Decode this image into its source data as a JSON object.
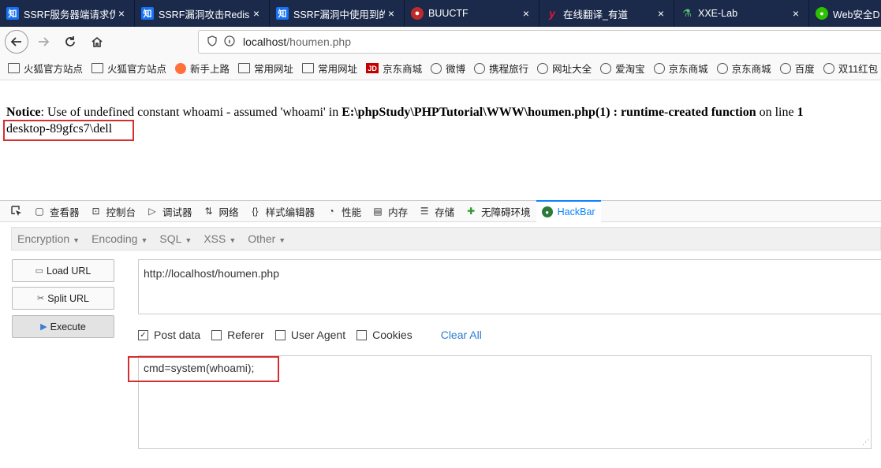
{
  "tabs": [
    {
      "icon": "知",
      "title": "SSRF服务器端请求伪"
    },
    {
      "icon": "知",
      "title": "SSRF漏洞攻击Redis"
    },
    {
      "icon": "知",
      "title": "SSRF漏洞中使用到的"
    },
    {
      "icon": "",
      "title": "BUUCTF"
    },
    {
      "icon": "y",
      "title": "在线翻译_有道"
    },
    {
      "icon": "",
      "title": "XXE-Lab"
    },
    {
      "icon": "",
      "title": "Web安全D"
    }
  ],
  "tab_close": "×",
  "nav": {
    "url_host": "localhost",
    "url_path": "/houmen.php"
  },
  "bookmarks": [
    {
      "type": "folder",
      "label": "火狐官方站点"
    },
    {
      "type": "folder",
      "label": "火狐官方站点"
    },
    {
      "type": "firefox",
      "label": "新手上路"
    },
    {
      "type": "folder",
      "label": "常用网址"
    },
    {
      "type": "folder",
      "label": "常用网址"
    },
    {
      "type": "jd",
      "icon_text": "JD",
      "label": "京东商城"
    },
    {
      "type": "globe",
      "label": "微博"
    },
    {
      "type": "globe",
      "label": "携程旅行"
    },
    {
      "type": "globe",
      "label": "网址大全"
    },
    {
      "type": "globe",
      "label": "爱淘宝"
    },
    {
      "type": "globe",
      "label": "京东商城"
    },
    {
      "type": "globe",
      "label": "京东商城"
    },
    {
      "type": "globe",
      "label": "百度"
    },
    {
      "type": "globe",
      "label": "双11红包"
    }
  ],
  "page": {
    "notice_label": "Notice",
    "notice_text": ": Use of undefined constant whoami - assumed 'whoami' in ",
    "notice_file": "E:\\phpStudy\\PHPTutorial\\WWW\\houmen.php(1) : runtime-created function",
    "notice_online": " on line ",
    "notice_line": "1",
    "output": "desktop-89gfcs7\\dell"
  },
  "devtools_tabs": [
    {
      "icon": "inspector-icon",
      "label": "查看器"
    },
    {
      "icon": "console-icon",
      "label": "控制台"
    },
    {
      "icon": "debugger-icon",
      "label": "调试器"
    },
    {
      "icon": "network-icon",
      "label": "网络"
    },
    {
      "icon": "style-editor-icon",
      "label": "样式编辑器"
    },
    {
      "icon": "performance-icon",
      "label": "性能"
    },
    {
      "icon": "memory-icon",
      "label": "内存"
    },
    {
      "icon": "storage-icon",
      "label": "存储"
    },
    {
      "icon": "accessibility-icon",
      "label": "无障碍环境"
    },
    {
      "icon": "hackbar-icon",
      "label": "HackBar",
      "active": true
    }
  ],
  "hackbar": {
    "menus": [
      "Encryption",
      "Encoding",
      "SQL",
      "XSS",
      "Other"
    ],
    "load_url": "Load URL",
    "split_url": "Split URL",
    "execute": "Execute",
    "url_value": "http://localhost/houmen.php",
    "options": [
      {
        "label": "Post data",
        "checked": true
      },
      {
        "label": "Referer",
        "checked": false
      },
      {
        "label": "User Agent",
        "checked": false
      },
      {
        "label": "Cookies",
        "checked": false
      }
    ],
    "clear_all": "Clear All",
    "post_value": "cmd=system(whoami);"
  },
  "colors": {
    "highlight_box": "#d62e2e",
    "tab_strip": "#1b2a4a",
    "link_blue": "#2a7bd6"
  }
}
